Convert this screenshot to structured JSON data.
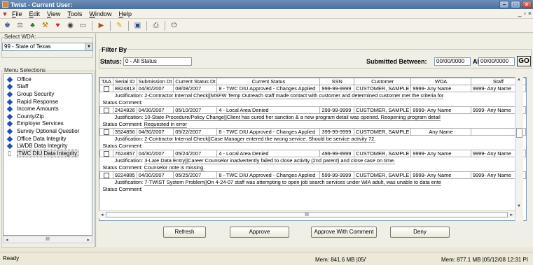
{
  "window": {
    "title": "Twist - Current User:"
  },
  "menubar": {
    "items": [
      {
        "label": "File",
        "key": "F",
        "rest": "ile"
      },
      {
        "label": "Edit",
        "key": "E",
        "rest": "dit"
      },
      {
        "label": "View",
        "key": "V",
        "rest": "iew"
      },
      {
        "label": "Tools",
        "key": "T",
        "rest": "ools"
      },
      {
        "label": "Window",
        "key": "W",
        "rest": "indow"
      },
      {
        "label": "Help",
        "key": "H",
        "rest": "elp"
      }
    ]
  },
  "toolbar": {
    "icons": [
      "staff-icon",
      "scale-icon",
      "tree-icon",
      "tools-icon",
      "heart-icon",
      "eye-icon",
      "window-icon",
      "arrow-icon",
      "key-icon",
      "save-icon",
      "print-icon",
      "plug-icon"
    ]
  },
  "left": {
    "wda_label": "Select WDA:",
    "wda_value": "99 - State of Texas",
    "menu_label": "Menu Selections",
    "items": [
      "Office",
      "Staff",
      "Group Security",
      "Rapid Response",
      "Income Amounts",
      "County/Zip",
      "Employer Services",
      "Survey Optional Questior",
      "Office Data Integrity",
      "LWDB Data Integrity",
      "TWC DIU Data Integrity"
    ],
    "selected_index": 10
  },
  "filter": {
    "label": "Filter By",
    "status_label": "Status:",
    "status_value": "0 - All Status",
    "submitted_label": "Submitted Between:",
    "date_from": "00/00/0000",
    "and_label": "AND",
    "date_to": "00/00/0000",
    "go_label": "GO"
  },
  "grid": {
    "columns": [
      "TAA",
      "Serial ID",
      "Submission Dt",
      "Current Status Dt",
      "Current Status",
      "SSN",
      "Customer",
      "WDA",
      "Staff"
    ],
    "justification_label": "Justification:",
    "status_comment_label": "Status Comment:",
    "rows": [
      {
        "serial": "8824813",
        "sub": "04/30/2007",
        "cur": "08/08/2007",
        "status": "8 - TWC DIU Approved - Changes Applied",
        "ssn": "999-99-9999",
        "customer": "CUSTOMER, SAMPLE",
        "wda": "9999- Any Name",
        "staff": "9999- Any Name",
        "justification": "2-Contractor Internal Check||MSFW Temp Outreach staff made contact with customer and determined customer met the criteria for",
        "status_comment": ""
      },
      {
        "serial": "2424826",
        "sub": "04/30/2007",
        "cur": "05/10/2007",
        "status": "4 - Local Area Denied",
        "ssn": "299-99-9999",
        "customer": "CUSTOMER, SAMPLE",
        "wda": "9999- Any Name",
        "staff": "9999- Any Name",
        "justification": "10-State Procedure/Policy Change||Client has cured her sanction & a new program detail was opened.  Reopening program detail",
        "status_comment": "Requested in error"
      },
      {
        "serial": "3524856",
        "sub": "04/30/2007",
        "cur": "05/22/2007",
        "status": "8 - TWC DIU Approved - Changes Applied",
        "ssn": "399-99-9999",
        "customer": "CUSTOMER, SAMPLE",
        "wda": "Any Name",
        "staff": "",
        "justification": "2-Contractor Internal Check||Case Manager entered the wrong service.  Should be service activity 72.",
        "status_comment": ""
      },
      {
        "serial": "7624857",
        "sub": "04/30/2007",
        "cur": "05/24/2007",
        "status": "4 - Local Area Denied",
        "ssn": "499-99-9999",
        "customer": "CUSTOMER, SAMPLE",
        "wda": "9999- Any Name",
        "staff": "9999- Any Name",
        "justification": "3-Late Data Entry||Career Counselor inadvertently failed to close activity (2nd parent) and close case on time.",
        "status_comment": "Counselor note is missing."
      },
      {
        "serial": "9224885",
        "sub": "04/30/2007",
        "cur": "05/25/2007",
        "status": "8 - TWC DIU Approved - Changes Applied",
        "ssn": "599-99-9999",
        "customer": "CUSTOMER, SAMPLE",
        "wda": "9999- Any Name",
        "staff": "9999- Any Name",
        "justification": "7-TWIST System Problem||On 4-24-07 staff was attempting to open job search services under  WIA adult, was unable to data ente",
        "status_comment": ""
      }
    ]
  },
  "buttons": {
    "refresh": "Refresh",
    "approve": "Approve",
    "approve_comment": "Approve With Comment",
    "deny": "Deny"
  },
  "statusbar": {
    "ready": "Ready",
    "mem1": "Mem: 841.6 MB |05/'",
    "mem2": "Mem: 877.1 MB |05/12/08 12:31 PI"
  },
  "colors": {
    "title_bg": "#4a6f9e",
    "tree_icon": "#1f4fb5",
    "selection": "#e8e8e8"
  }
}
